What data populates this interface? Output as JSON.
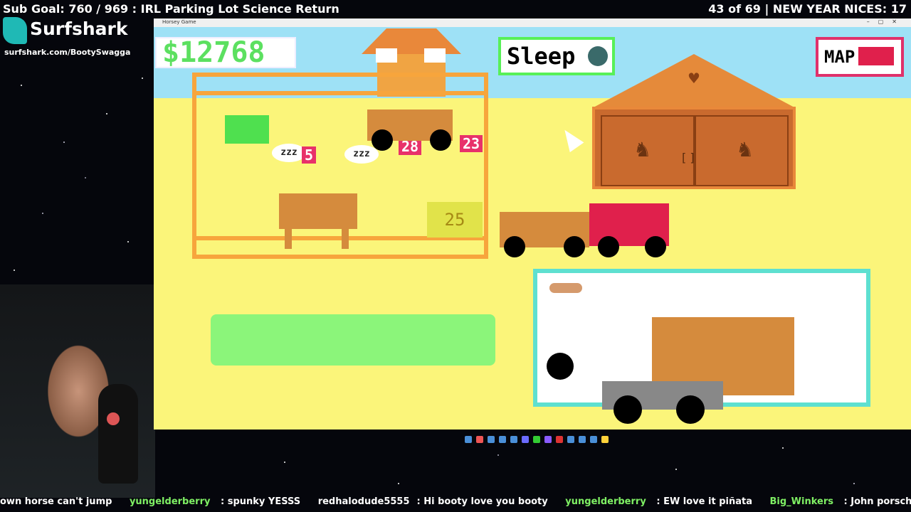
{
  "overlay": {
    "sub_goal": "Sub Goal: 760 / 969 : IRL Parking Lot Science Return",
    "counter": "43 of 69 | NEW YEAR NICES: 17"
  },
  "sponsor": {
    "name": "Surfshark",
    "url": "surfshark.com/BootySwagga"
  },
  "window": {
    "title": "Horsey Game"
  },
  "game": {
    "money": "$12768",
    "sleep_label": "Sleep",
    "map_label": "MAP",
    "hay_count": "25",
    "bubble_1": "zzz",
    "bubble_2": "zzz",
    "tag_1": "5",
    "tag_2": "28",
    "tag_3": "23",
    "barn_door_label": "[ ]"
  },
  "chat": [
    {
      "user": "",
      "text": "own horse can't jump"
    },
    {
      "user": "yungelderberry",
      "text": "spunky YESSS"
    },
    {
      "user": "redhalodude5555",
      "text": "Hi booty love you booty"
    },
    {
      "user": "yungelderberry",
      "text": "EW love it piñata"
    },
    {
      "user": "Big_Winkers",
      "text": "John porsche is calling"
    }
  ],
  "colors": {
    "ground": "#fbf57a",
    "sky": "#9ee1f6",
    "money_text": "#5ce060",
    "sleep_border": "#58f058",
    "map_border": "#e0316b",
    "trailer_border": "#5ee0d0"
  }
}
